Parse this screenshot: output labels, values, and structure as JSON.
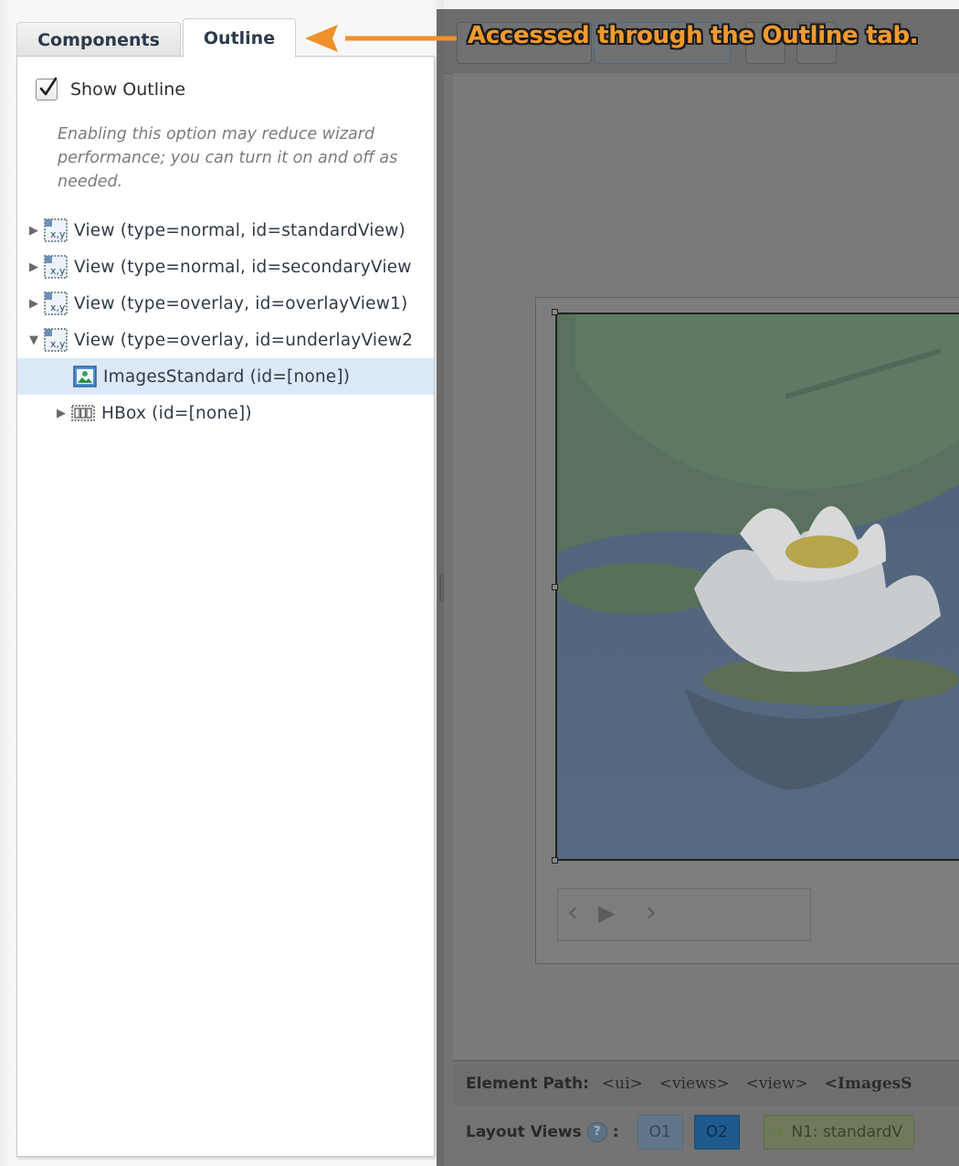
{
  "callout": {
    "text": "Accessed through the Outline tab."
  },
  "tabs": {
    "components": "Components",
    "outline": "Outline"
  },
  "outline_panel": {
    "show_outline_label": "Show Outline",
    "show_outline_checked": true,
    "hint": "Enabling this option may reduce wizard performance; you can turn it on and off as needed.",
    "tree": [
      {
        "label": "View (type=normal, id=standardView)",
        "toggle": "▶",
        "icon": "view-icon"
      },
      {
        "label": "View (type=normal, id=secondaryView",
        "toggle": "▶",
        "icon": "view-icon"
      },
      {
        "label": "View (type=overlay, id=overlayView1)",
        "toggle": "▶",
        "icon": "view-icon"
      },
      {
        "label": "View (type=overlay, id=underlayView2",
        "toggle": "▼",
        "icon": "view-icon"
      },
      {
        "label": "ImagesStandard (id=[none])",
        "toggle": "",
        "icon": "images-icon",
        "selected": true
      },
      {
        "label": "HBox (id=[none])",
        "toggle": "▶",
        "icon": "hbox-icon"
      }
    ]
  },
  "player": {
    "prev": "‹",
    "play": "▶",
    "next": "›"
  },
  "element_path": {
    "label": "Element Path:",
    "crumbs": [
      "<ui>",
      "<views>",
      "<view>",
      "<ImagesS"
    ]
  },
  "layout_views": {
    "label": "Layout Views",
    "help_glyph": "?",
    "colon": ":",
    "o1": "O1",
    "o2": "O2",
    "n1": "N1: standardV",
    "n1_arrow": "⇨"
  },
  "colors": {
    "callout_fill": "#f29a2e",
    "arrow": "#f0902a",
    "selection": "#dbe8f7"
  }
}
